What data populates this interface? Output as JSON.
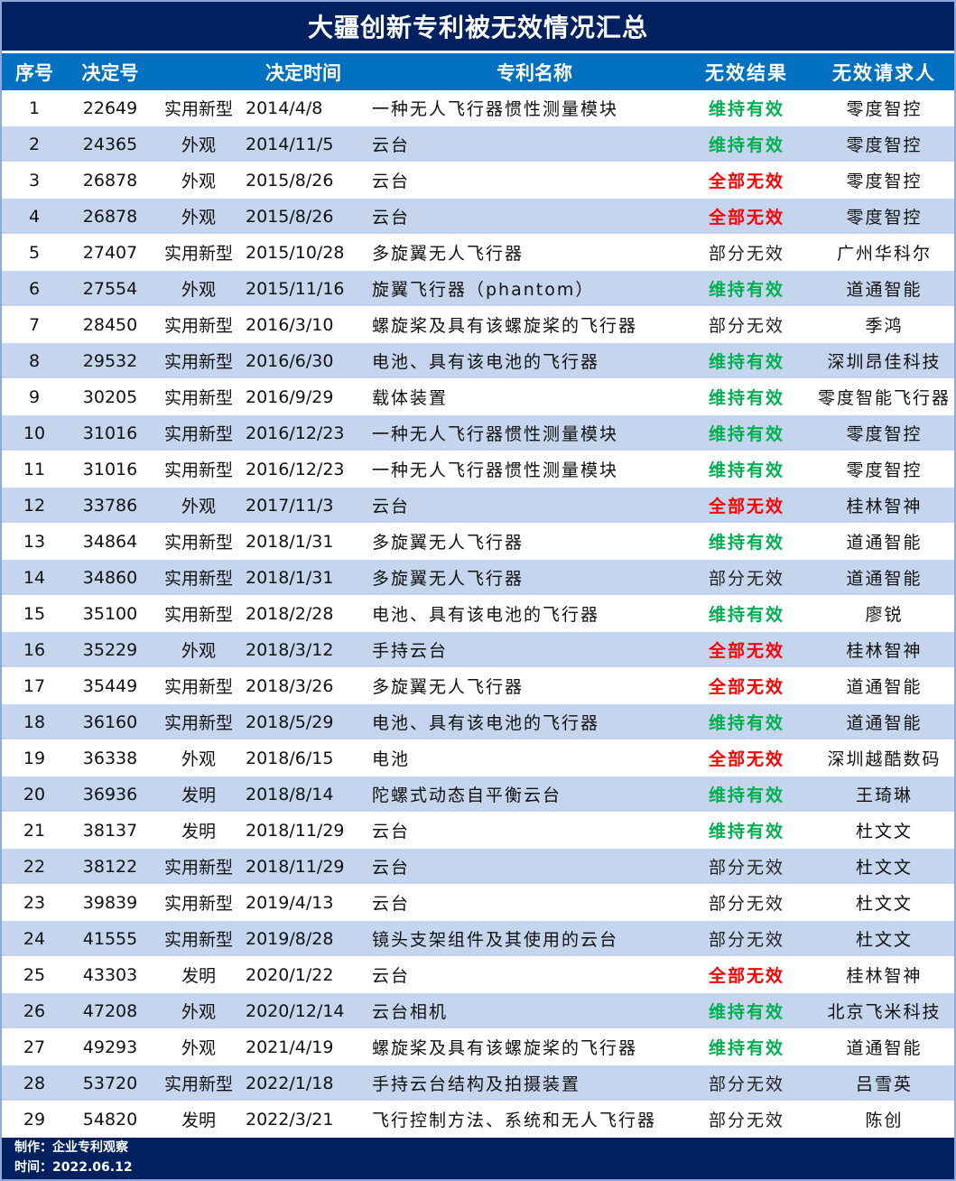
{
  "title": "大疆创新专利被无效情况汇总",
  "headers": [
    "序号",
    "决定号",
    "决定时间",
    "专利名称",
    "无效结果",
    "无效请求人"
  ],
  "rows": [
    [
      "1",
      "22649",
      "实用新型",
      "2014/4/8",
      "一种无人飞行器惯性测量模块",
      "维持有效",
      "零度智控"
    ],
    [
      "2",
      "24365",
      "外观",
      "2014/11/5",
      "云台",
      "维持有效",
      "零度智控"
    ],
    [
      "3",
      "26878",
      "外观",
      "2015/8/26",
      "云台",
      "全部无效",
      "零度智控"
    ],
    [
      "4",
      "26878",
      "外观",
      "2015/8/26",
      "云台",
      "全部无效",
      "零度智控"
    ],
    [
      "5",
      "27407",
      "实用新型",
      "2015/10/28",
      "多旋翼无人飞行器",
      "部分无效",
      "广州华科尔"
    ],
    [
      "6",
      "27554",
      "外观",
      "2015/11/16",
      "旋翼飞行器（phantom）",
      "维持有效",
      "道通智能"
    ],
    [
      "7",
      "28450",
      "实用新型",
      "2016/3/10",
      "螺旋桨及具有该螺旋桨的飞行器",
      "部分无效",
      "季鸿"
    ],
    [
      "8",
      "29532",
      "实用新型",
      "2016/6/30",
      "电池、具有该电池的飞行器",
      "维持有效",
      "深圳昂佳科技"
    ],
    [
      "9",
      "30205",
      "实用新型",
      "2016/9/29",
      "载体装置",
      "维持有效",
      "零度智能飞行器"
    ],
    [
      "10",
      "31016",
      "实用新型",
      "2016/12/23",
      "一种无人飞行器惯性测量模块",
      "维持有效",
      "零度智控"
    ],
    [
      "11",
      "31016",
      "实用新型",
      "2016/12/23",
      "一种无人飞行器惯性测量模块",
      "维持有效",
      "零度智控"
    ],
    [
      "12",
      "33786",
      "外观",
      "2017/11/3",
      "云台",
      "全部无效",
      "桂林智神"
    ],
    [
      "13",
      "34864",
      "实用新型",
      "2018/1/31",
      "多旋翼无人飞行器",
      "维持有效",
      "道通智能"
    ],
    [
      "14",
      "34860",
      "实用新型",
      "2018/1/31",
      "多旋翼无人飞行器",
      "部分无效",
      "道通智能"
    ],
    [
      "15",
      "35100",
      "实用新型",
      "2018/2/28",
      "电池、具有该电池的飞行器",
      "维持有效",
      "廖锐"
    ],
    [
      "16",
      "35229",
      "外观",
      "2018/3/12",
      "手持云台",
      "全部无效",
      "桂林智神"
    ],
    [
      "17",
      "35449",
      "实用新型",
      "2018/3/26",
      "多旋翼无人飞行器",
      "全部无效",
      "道通智能"
    ],
    [
      "18",
      "36160",
      "实用新型",
      "2018/5/29",
      "电池、具有该电池的飞行器",
      "维持有效",
      "道通智能"
    ],
    [
      "19",
      "36338",
      "外观",
      "2018/6/15",
      "电池",
      "全部无效",
      "深圳越酷数码"
    ],
    [
      "20",
      "36936",
      "发明",
      "2018/8/14",
      "陀螺式动态自平衡云台",
      "维持有效",
      "王琦琳"
    ],
    [
      "21",
      "38137",
      "发明",
      "2018/11/29",
      "云台",
      "维持有效",
      "杜文文"
    ],
    [
      "22",
      "38122",
      "实用新型",
      "2018/11/29",
      "云台",
      "部分无效",
      "杜文文"
    ],
    [
      "23",
      "39839",
      "实用新型",
      "2019/4/13",
      "云台",
      "部分无效",
      "杜文文"
    ],
    [
      "24",
      "41555",
      "实用新型",
      "2019/8/28",
      "镜头支架组件及其使用的云台",
      "部分无效",
      "杜文文"
    ],
    [
      "25",
      "43303",
      "发明",
      "2020/1/22",
      "云台",
      "全部无效",
      "桂林智神"
    ],
    [
      "26",
      "47208",
      "外观",
      "2020/12/14",
      "云台相机",
      "维持有效",
      "北京飞米科技"
    ],
    [
      "27",
      "49293",
      "外观",
      "2021/4/19",
      "螺旋桨及具有该螺旋桨的飞行器",
      "维持有效",
      "道通智能"
    ],
    [
      "28",
      "53720",
      "实用新型",
      "2022/1/18",
      "手持云台结构及拍摄装置",
      "部分无效",
      "吕雪英"
    ],
    [
      "29",
      "54820",
      "发明",
      "2022/3/21",
      "飞行控制方法、系统和无人飞行器",
      "部分无效",
      "陈创"
    ]
  ],
  "result_colors": {
    "维持有效": "#00b050",
    "全部无效": "#ff0000",
    "部分无效": "#222222"
  },
  "footer": {
    "maker": "制作：企业专利观察",
    "date": "时间：2022.06.12"
  }
}
